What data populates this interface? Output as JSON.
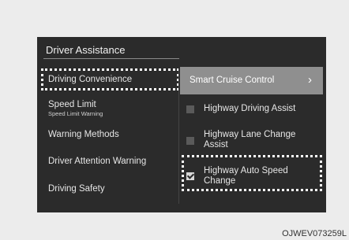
{
  "screen": {
    "title": "Driver Assistance",
    "left_menu": [
      {
        "label": "Driving Convenience",
        "sub": ""
      },
      {
        "label": "Speed Limit",
        "sub": "Speed Limit Warning"
      },
      {
        "label": "Warning Methods",
        "sub": ""
      },
      {
        "label": "Driver Attention Warning",
        "sub": ""
      },
      {
        "label": "Driving Safety",
        "sub": ""
      }
    ],
    "right_menu": {
      "smart_cruise": {
        "label": "Smart Cruise Control",
        "chevron": "›"
      },
      "options": [
        {
          "label": "Highway Driving Assist",
          "checked": false
        },
        {
          "label": "Highway Lane Change Assist",
          "checked": false
        },
        {
          "label": "Highway Auto Speed Change",
          "checked": true
        }
      ]
    }
  },
  "image_code": "OJWEV073259L",
  "colors": {
    "screen_bg": "#2b2b2b",
    "highlight": "#8f8f8f",
    "page_bg": "#ececec"
  }
}
